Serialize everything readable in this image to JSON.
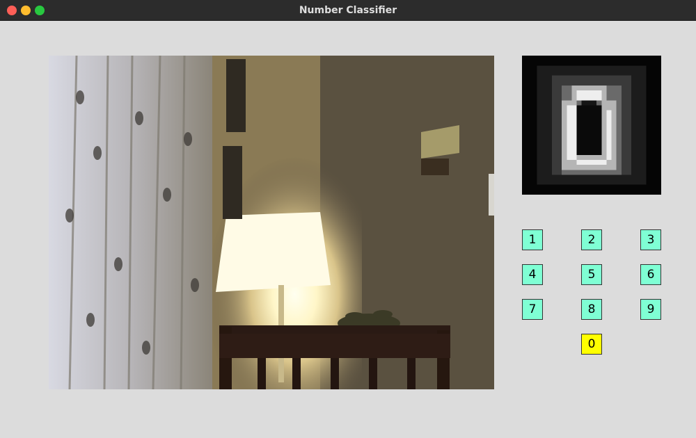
{
  "window": {
    "title": "Number Classifier"
  },
  "camera": {
    "description": "Live webcam feed"
  },
  "preview": {
    "description": "Processed 28x28 digit preview"
  },
  "keypad": {
    "keys": [
      "1",
      "2",
      "3",
      "4",
      "5",
      "6",
      "7",
      "8",
      "9",
      "0"
    ],
    "selected": "0",
    "colors": {
      "default": "#7fffd4",
      "selected": "#ffff00"
    }
  }
}
